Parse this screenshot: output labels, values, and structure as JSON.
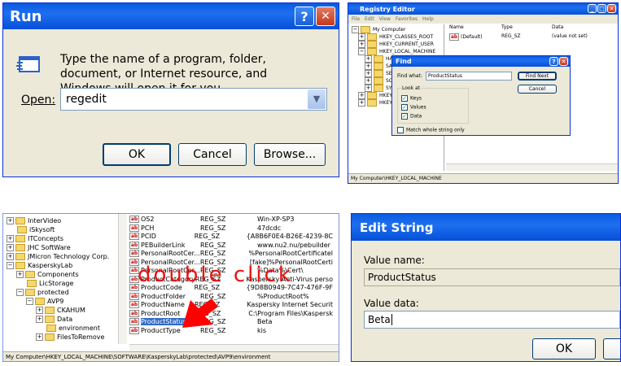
{
  "run": {
    "title": "Run",
    "help": "?",
    "close": "✕",
    "prompt": "Type the name of a program, folder, document, or Internet resource, and Windows will open it for you.",
    "open_label": "Open:",
    "input_value": "regedit",
    "ok": "OK",
    "cancel": "Cancel",
    "browse": "Browse..."
  },
  "regedit": {
    "title": "Registry Editor",
    "menu": [
      "File",
      "Edit",
      "View",
      "Favorites",
      "Help"
    ],
    "tree": [
      "My Computer",
      "HKEY_CLASSES_ROOT",
      "HKEY_CURRENT_USER",
      "HKEY_LOCAL_MACHINE",
      "HAR",
      "SAI",
      "SE",
      "SO",
      "SY",
      "HKEY_",
      "HKEY_"
    ],
    "cols": [
      "Name",
      "Type",
      "Data"
    ],
    "row": {
      "name": "(Default)",
      "type": "REG_SZ",
      "data": "(value not set)"
    },
    "status": "My Computer\\HKEY_LOCAL_MACHINE"
  },
  "find": {
    "title": "Find",
    "help": "?",
    "close": "✕",
    "find_what_label": "Find what:",
    "find_what_value": "ProductStatus",
    "find_next": "Find Next",
    "cancel": "Cancel",
    "look_at": "Look at",
    "keys": "Keys",
    "values": "Values",
    "data": "Data",
    "match": "Match whole string only"
  },
  "reg2": {
    "tree": [
      "InterVideo",
      "iSkysoft",
      "ITConcepts",
      "JHC SoftWare",
      "JMicron Technology Corp.",
      "KasperskyLab",
      "Components",
      "LicStorage",
      "protected",
      "AVP9",
      "CKAHUM",
      "Data",
      "environment",
      "FilesToRemove"
    ],
    "rows": [
      [
        "OS2",
        "REG_SZ",
        "Win-XP-SP3"
      ],
      [
        "PCH",
        "REG_SZ",
        "47dcdc"
      ],
      [
        "PCID",
        "REG_SZ",
        "{A8B6F0E4-B26E-4239-8C"
      ],
      [
        "PEBuilderLink",
        "REG_SZ",
        "www.nu2.nu/pebuilder"
      ],
      [
        "PersonalRootCer...",
        "REG_SZ",
        "%PersonalRootCertificatel"
      ],
      [
        "PersonalRootCer...",
        "REG_SZ",
        "[fake]%PersonalRootCerti"
      ],
      [
        "PersonalRootCer...",
        "REG_SZ",
        "%Data%\\Cert\\"
      ],
      [
        "ProductCategory",
        "REG_SZ",
        "Kaspersky Anti-Virus perso"
      ],
      [
        "ProductCode",
        "REG_SZ",
        "{9D8B0949-7C47-476F-9F"
      ],
      [
        "ProductFolder",
        "REG_SZ",
        "%ProductRoot%"
      ],
      [
        "ProductName",
        "REG_SZ",
        "Kaspersky Internet Securit"
      ],
      [
        "ProductRoot",
        "REG_SZ",
        "C:\\Program Files\\Kaspersk"
      ],
      [
        "ProductStatus",
        "REG_SZ",
        "Beta"
      ],
      [
        "ProductType",
        "REG_SZ",
        "kis"
      ]
    ],
    "status": "My Computer\\HKEY_LOCAL_MACHINE\\SOFTWARE\\KasperskyLab\\protected\\AVP9\\environment",
    "annotation": "double click"
  },
  "edit": {
    "title": "Edit String",
    "name_label": "Value name:",
    "name_value": "ProductStatus",
    "data_label": "Value data:",
    "data_value": "Beta",
    "ok": "OK"
  }
}
